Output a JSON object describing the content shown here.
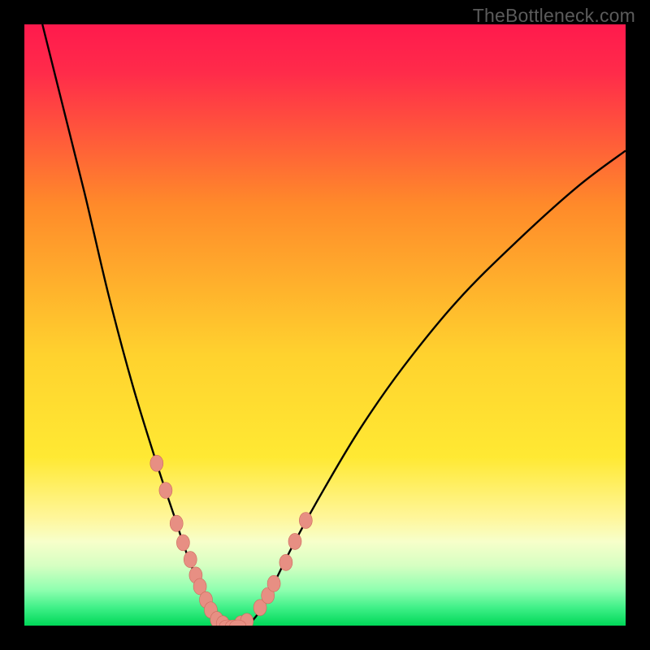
{
  "watermark": "TheBottleneck.com",
  "colors": {
    "frame": "#000000",
    "grad_top": "#ff1a4d",
    "grad_mid1": "#ff8a2a",
    "grad_mid2": "#ffe933",
    "grad_low1": "#f7ffb0",
    "grad_low2": "#7affae",
    "grad_bottom": "#00e060",
    "curve": "#000000",
    "marker_fill": "#e78f83",
    "marker_stroke": "#cc6a5c"
  },
  "chart_data": {
    "type": "line",
    "title": "",
    "xlabel": "",
    "ylabel": "",
    "xlim": [
      0,
      100
    ],
    "ylim": [
      0,
      100
    ],
    "curve_left": {
      "x": [
        3,
        6,
        10,
        14,
        18,
        22,
        25,
        27,
        29,
        30.5,
        32,
        33
      ],
      "y": [
        100,
        88,
        72,
        55,
        40,
        27,
        18,
        12,
        7,
        4,
        1.5,
        0
      ]
    },
    "curve_right": {
      "x": [
        37,
        38.5,
        40,
        42,
        45,
        50,
        56,
        63,
        72,
        82,
        92,
        100
      ],
      "y": [
        0,
        1.5,
        4,
        8,
        14,
        23,
        33,
        43,
        54,
        64,
        73,
        79
      ]
    },
    "markers_left": {
      "x": [
        22.0,
        23.5,
        25.3,
        26.4,
        27.6,
        28.5,
        29.2,
        30.2,
        31.0,
        32.0,
        33.0
      ],
      "y": [
        27.0,
        22.5,
        17.0,
        13.8,
        11.0,
        8.4,
        6.5,
        4.3,
        2.6,
        1.0,
        0.3
      ]
    },
    "markers_right": {
      "x": [
        36.0,
        37.0,
        39.2,
        40.5,
        41.5,
        43.5,
        45.0,
        46.8
      ],
      "y": [
        0.3,
        0.7,
        3.0,
        5.0,
        7.0,
        10.5,
        14.0,
        17.5
      ]
    },
    "markers_bottom": {
      "x": [
        33.8,
        34.8,
        35.5
      ],
      "y": [
        0.0,
        0.0,
        0.0
      ]
    }
  }
}
